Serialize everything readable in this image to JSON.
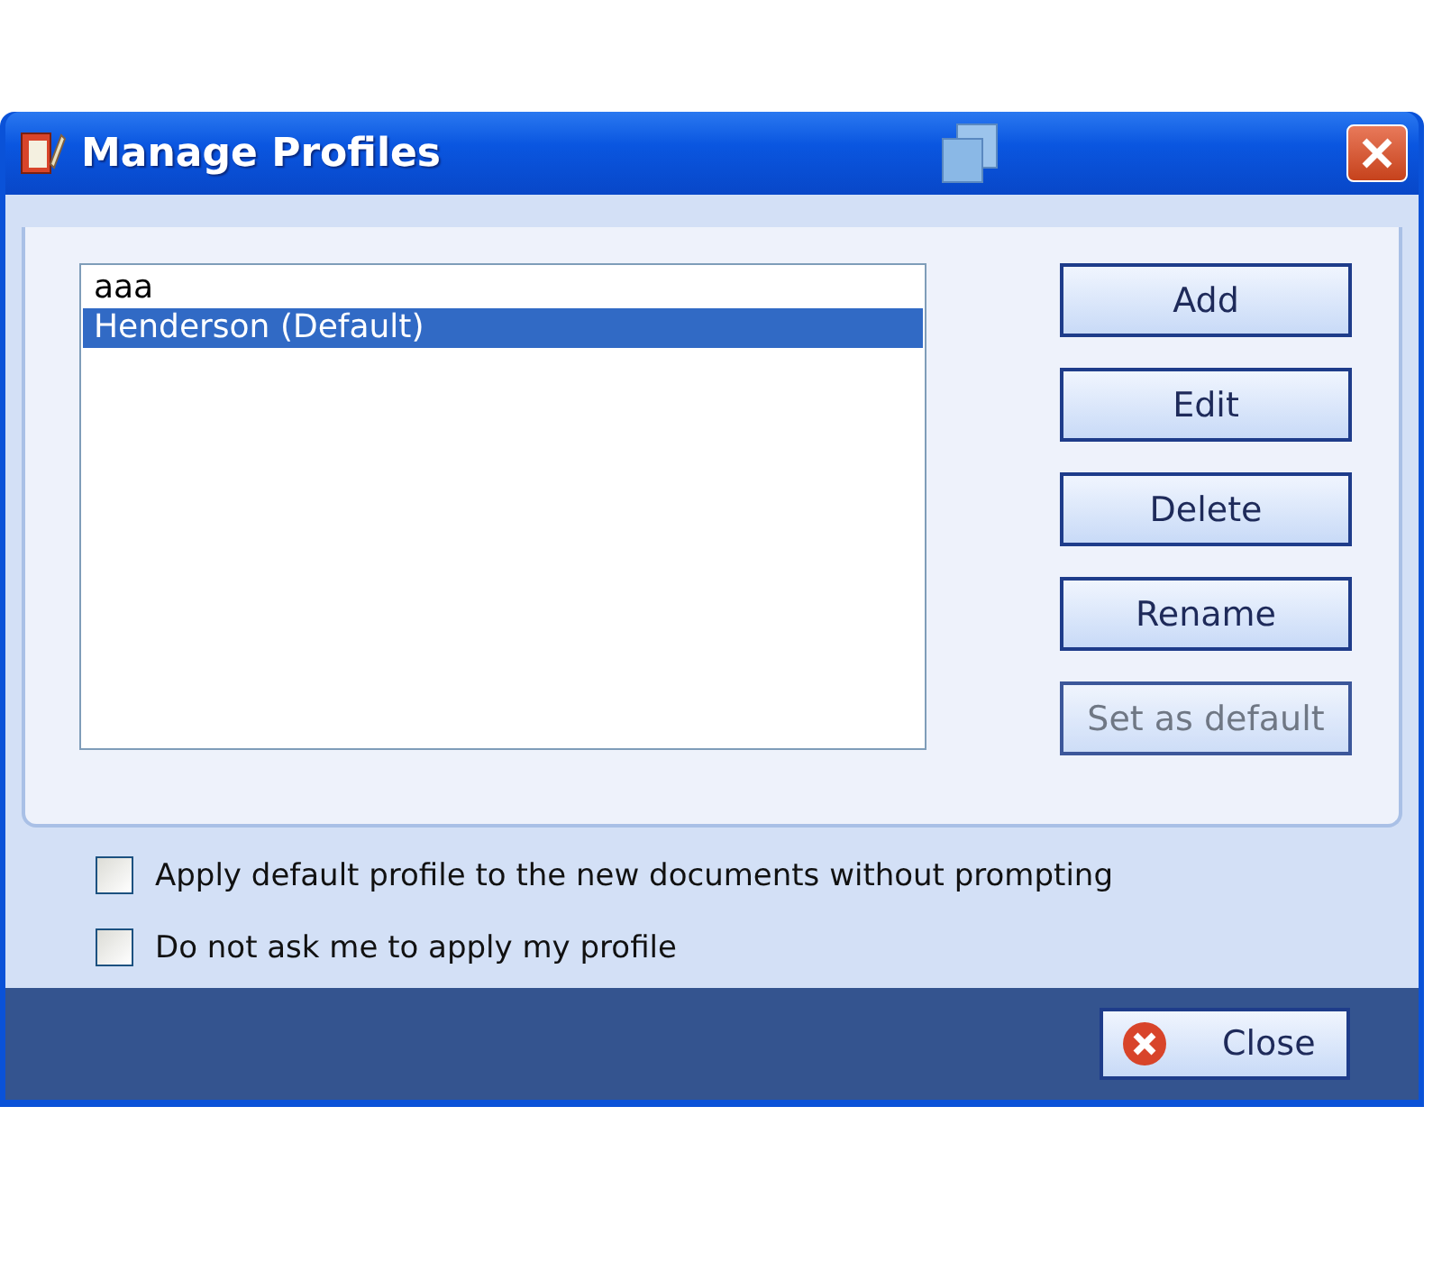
{
  "window": {
    "title": "Manage Profiles"
  },
  "profiles": [
    {
      "name": "aaa",
      "selected": false
    },
    {
      "name": "Henderson (Default)",
      "selected": true
    }
  ],
  "buttons": [
    {
      "label": "Add",
      "disabled": false
    },
    {
      "label": "Edit",
      "disabled": false
    },
    {
      "label": "Delete",
      "disabled": false
    },
    {
      "label": "Rename",
      "disabled": false
    },
    {
      "label": "Set as default",
      "disabled": true
    }
  ],
  "options": [
    {
      "label": "Apply default profile to the new documents without prompting",
      "checked": false
    },
    {
      "label": "Do not ask me to apply my profile",
      "checked": false
    }
  ],
  "footer": {
    "close_button": "Close"
  }
}
